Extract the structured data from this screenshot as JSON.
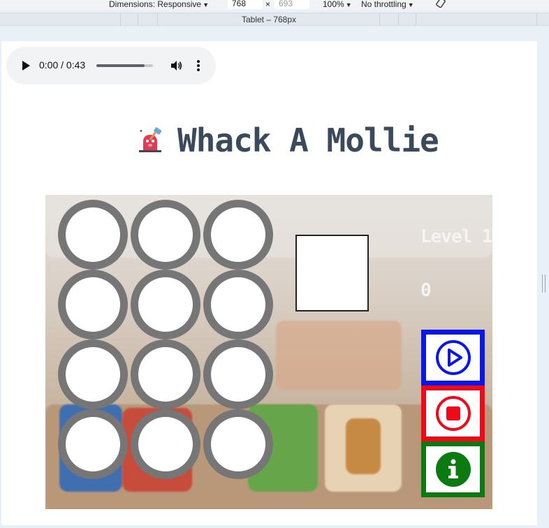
{
  "devtools": {
    "dimensions_label": "Dimensions: Responsive",
    "width_value": "768",
    "times": "×",
    "height_value": "693",
    "zoom": "100%",
    "throttling": "No throttling",
    "device_label": "Tablet – 768px",
    "rotate_icon": "rotate-icon"
  },
  "audio": {
    "time": "0:00 / 0:43",
    "progress": 0.85,
    "play_icon": "play-icon",
    "volume_icon": "volume-icon",
    "more_icon": "more-vert-icon"
  },
  "header": {
    "title": "Whack A Mollie",
    "logo_icon": "mole-hammer-icon"
  },
  "game": {
    "hole_count": 12,
    "level": "Level 1",
    "score": "0",
    "start_icon": "play-circle-icon",
    "stop_icon": "stop-circle-icon",
    "info_icon": "info-icon"
  },
  "colors": {
    "title": "#3b4a5b",
    "hole_border": "#767676",
    "start_border": "#0b16e8",
    "stop_border": "#f00a19",
    "info_border": "#0a7a11"
  }
}
